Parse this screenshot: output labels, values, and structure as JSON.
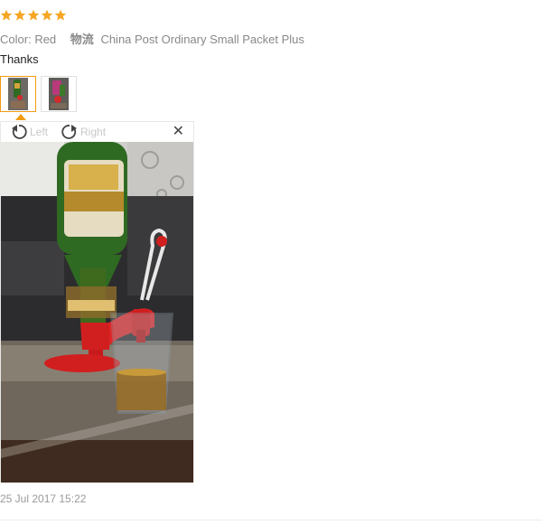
{
  "review": {
    "rating": 5,
    "star_color": "#f5a623",
    "color_label": "Color:",
    "color_value": "Red",
    "shipping_label": "物流",
    "shipping_value": "China Post Ordinary Small Packet Plus",
    "feedback_text": "Thanks",
    "thumbnails": [
      {
        "icon": "photo-thumbnail-icon",
        "active": true
      },
      {
        "icon": "photo-thumbnail-icon",
        "active": false
      }
    ],
    "viewer": {
      "rotate_left_label": "Left",
      "rotate_right_label": "Right",
      "close_icon": "close-icon",
      "photo_icon": "review-photo-beer-dispenser"
    },
    "date": "25 Jul 2017 15:22"
  }
}
